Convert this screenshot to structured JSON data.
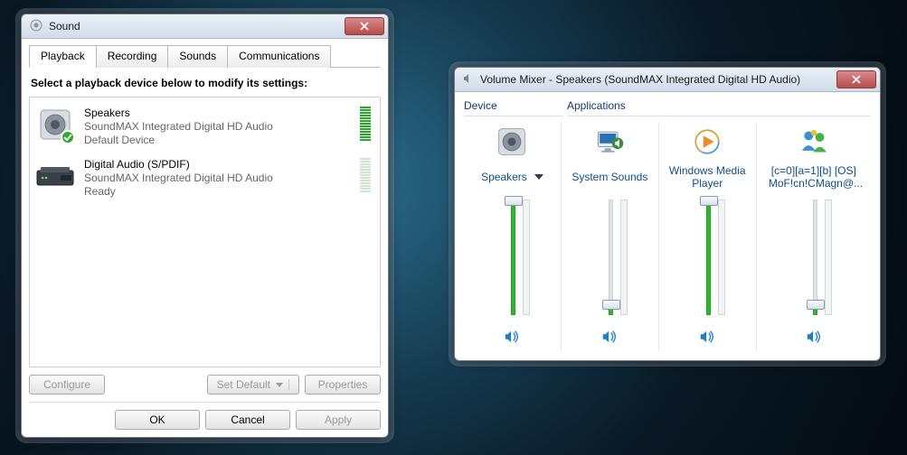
{
  "sound": {
    "title": "Sound",
    "tabs": [
      "Playback",
      "Recording",
      "Sounds",
      "Communications"
    ],
    "instruction": "Select a playback device below to modify its settings:",
    "devices": [
      {
        "name": "Speakers",
        "desc": "SoundMAX Integrated Digital HD Audio",
        "status": "Default Device",
        "level": "full"
      },
      {
        "name": "Digital Audio (S/PDIF)",
        "desc": "SoundMAX Integrated Digital HD Audio",
        "status": "Ready",
        "level": "idle"
      }
    ],
    "buttons": {
      "configure": "Configure",
      "setdefault": "Set Default",
      "properties": "Properties",
      "ok": "OK",
      "cancel": "Cancel",
      "apply": "Apply"
    }
  },
  "mixer": {
    "title": "Volume Mixer - Speakers (SoundMAX Integrated Digital HD Audio)",
    "headers": {
      "device": "Device",
      "applications": "Applications"
    },
    "columns": [
      {
        "label": "Speakers",
        "icon": "speakers",
        "volume": 100,
        "dropdown": true
      },
      {
        "label": "System Sounds",
        "icon": "system",
        "volume": 10
      },
      {
        "label": "Windows Media Player",
        "icon": "wmp",
        "volume": 100
      },
      {
        "label": "[c=0][a=1][b] [OS] MoF!cn!CMagn@...",
        "icon": "msn",
        "volume": 10
      }
    ]
  }
}
